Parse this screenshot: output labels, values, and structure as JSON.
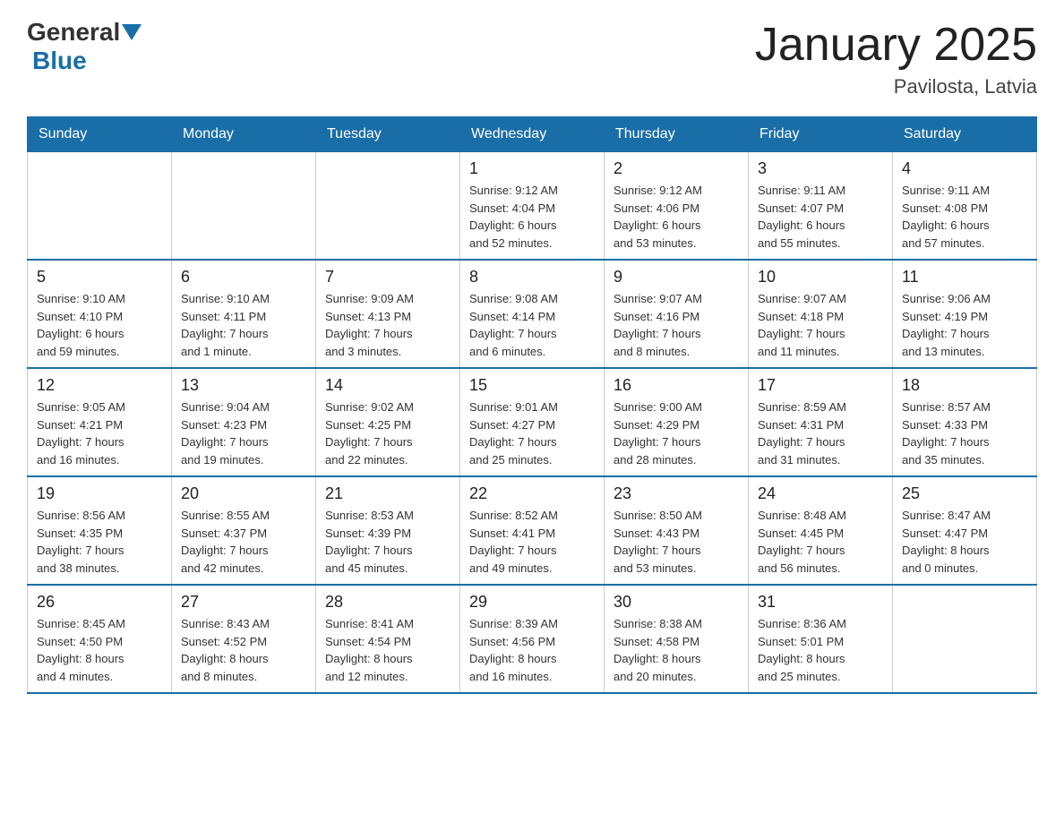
{
  "header": {
    "title": "January 2025",
    "subtitle": "Pavilosta, Latvia",
    "logo": {
      "general": "General",
      "blue": "Blue"
    }
  },
  "weekdays": [
    "Sunday",
    "Monday",
    "Tuesday",
    "Wednesday",
    "Thursday",
    "Friday",
    "Saturday"
  ],
  "weeks": [
    [
      {
        "day": "",
        "info": ""
      },
      {
        "day": "",
        "info": ""
      },
      {
        "day": "",
        "info": ""
      },
      {
        "day": "1",
        "info": "Sunrise: 9:12 AM\nSunset: 4:04 PM\nDaylight: 6 hours\nand 52 minutes."
      },
      {
        "day": "2",
        "info": "Sunrise: 9:12 AM\nSunset: 4:06 PM\nDaylight: 6 hours\nand 53 minutes."
      },
      {
        "day": "3",
        "info": "Sunrise: 9:11 AM\nSunset: 4:07 PM\nDaylight: 6 hours\nand 55 minutes."
      },
      {
        "day": "4",
        "info": "Sunrise: 9:11 AM\nSunset: 4:08 PM\nDaylight: 6 hours\nand 57 minutes."
      }
    ],
    [
      {
        "day": "5",
        "info": "Sunrise: 9:10 AM\nSunset: 4:10 PM\nDaylight: 6 hours\nand 59 minutes."
      },
      {
        "day": "6",
        "info": "Sunrise: 9:10 AM\nSunset: 4:11 PM\nDaylight: 7 hours\nand 1 minute."
      },
      {
        "day": "7",
        "info": "Sunrise: 9:09 AM\nSunset: 4:13 PM\nDaylight: 7 hours\nand 3 minutes."
      },
      {
        "day": "8",
        "info": "Sunrise: 9:08 AM\nSunset: 4:14 PM\nDaylight: 7 hours\nand 6 minutes."
      },
      {
        "day": "9",
        "info": "Sunrise: 9:07 AM\nSunset: 4:16 PM\nDaylight: 7 hours\nand 8 minutes."
      },
      {
        "day": "10",
        "info": "Sunrise: 9:07 AM\nSunset: 4:18 PM\nDaylight: 7 hours\nand 11 minutes."
      },
      {
        "day": "11",
        "info": "Sunrise: 9:06 AM\nSunset: 4:19 PM\nDaylight: 7 hours\nand 13 minutes."
      }
    ],
    [
      {
        "day": "12",
        "info": "Sunrise: 9:05 AM\nSunset: 4:21 PM\nDaylight: 7 hours\nand 16 minutes."
      },
      {
        "day": "13",
        "info": "Sunrise: 9:04 AM\nSunset: 4:23 PM\nDaylight: 7 hours\nand 19 minutes."
      },
      {
        "day": "14",
        "info": "Sunrise: 9:02 AM\nSunset: 4:25 PM\nDaylight: 7 hours\nand 22 minutes."
      },
      {
        "day": "15",
        "info": "Sunrise: 9:01 AM\nSunset: 4:27 PM\nDaylight: 7 hours\nand 25 minutes."
      },
      {
        "day": "16",
        "info": "Sunrise: 9:00 AM\nSunset: 4:29 PM\nDaylight: 7 hours\nand 28 minutes."
      },
      {
        "day": "17",
        "info": "Sunrise: 8:59 AM\nSunset: 4:31 PM\nDaylight: 7 hours\nand 31 minutes."
      },
      {
        "day": "18",
        "info": "Sunrise: 8:57 AM\nSunset: 4:33 PM\nDaylight: 7 hours\nand 35 minutes."
      }
    ],
    [
      {
        "day": "19",
        "info": "Sunrise: 8:56 AM\nSunset: 4:35 PM\nDaylight: 7 hours\nand 38 minutes."
      },
      {
        "day": "20",
        "info": "Sunrise: 8:55 AM\nSunset: 4:37 PM\nDaylight: 7 hours\nand 42 minutes."
      },
      {
        "day": "21",
        "info": "Sunrise: 8:53 AM\nSunset: 4:39 PM\nDaylight: 7 hours\nand 45 minutes."
      },
      {
        "day": "22",
        "info": "Sunrise: 8:52 AM\nSunset: 4:41 PM\nDaylight: 7 hours\nand 49 minutes."
      },
      {
        "day": "23",
        "info": "Sunrise: 8:50 AM\nSunset: 4:43 PM\nDaylight: 7 hours\nand 53 minutes."
      },
      {
        "day": "24",
        "info": "Sunrise: 8:48 AM\nSunset: 4:45 PM\nDaylight: 7 hours\nand 56 minutes."
      },
      {
        "day": "25",
        "info": "Sunrise: 8:47 AM\nSunset: 4:47 PM\nDaylight: 8 hours\nand 0 minutes."
      }
    ],
    [
      {
        "day": "26",
        "info": "Sunrise: 8:45 AM\nSunset: 4:50 PM\nDaylight: 8 hours\nand 4 minutes."
      },
      {
        "day": "27",
        "info": "Sunrise: 8:43 AM\nSunset: 4:52 PM\nDaylight: 8 hours\nand 8 minutes."
      },
      {
        "day": "28",
        "info": "Sunrise: 8:41 AM\nSunset: 4:54 PM\nDaylight: 8 hours\nand 12 minutes."
      },
      {
        "day": "29",
        "info": "Sunrise: 8:39 AM\nSunset: 4:56 PM\nDaylight: 8 hours\nand 16 minutes."
      },
      {
        "day": "30",
        "info": "Sunrise: 8:38 AM\nSunset: 4:58 PM\nDaylight: 8 hours\nand 20 minutes."
      },
      {
        "day": "31",
        "info": "Sunrise: 8:36 AM\nSunset: 5:01 PM\nDaylight: 8 hours\nand 25 minutes."
      },
      {
        "day": "",
        "info": ""
      }
    ]
  ]
}
